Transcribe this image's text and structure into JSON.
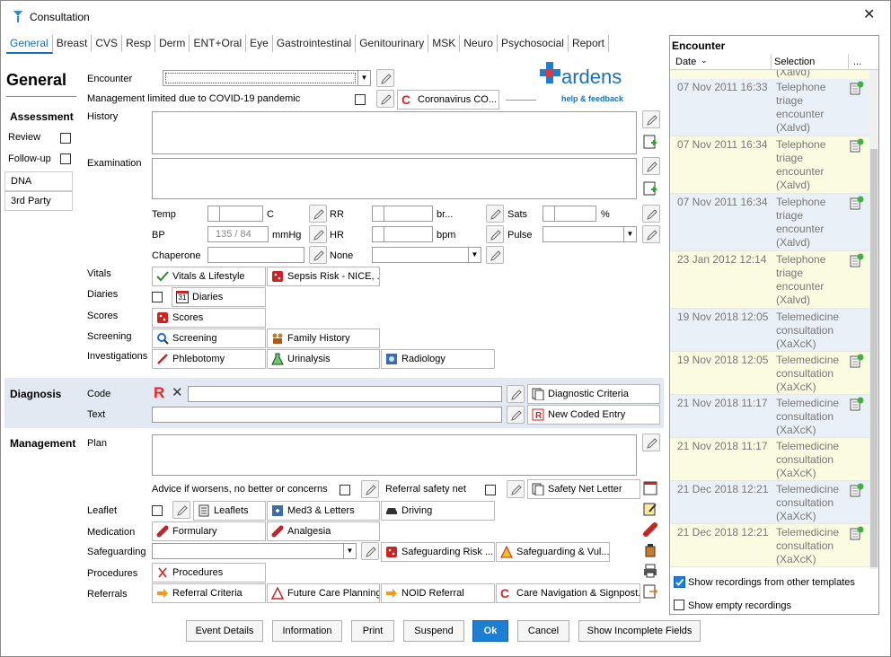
{
  "window": {
    "title": "Consultation"
  },
  "tabs": [
    "General",
    "Breast",
    "CVS",
    "Resp",
    "Derm",
    "ENT+Oral",
    "Eye",
    "Gastrointestinal",
    "Genitourinary",
    "MSK",
    "Neuro",
    "Psychosocial",
    "Report"
  ],
  "general": {
    "heading": "General",
    "encounter_label": "Encounter",
    "covid_label": "Management limited due to COVID-19 pandemic",
    "covid_button": "Coronavirus CO...",
    "history_label": "History",
    "examination_label": "Examination"
  },
  "ardens": {
    "name": "ardens",
    "sub": "help & feedback"
  },
  "assessment": {
    "heading": "Assessment",
    "review": "Review",
    "followup": "Follow-up",
    "dna": "DNA",
    "third_party": "3rd Party"
  },
  "vitals_row": {
    "temp": "Temp",
    "temp_unit": "C",
    "rr": "RR",
    "rr_unit": "br...",
    "sats": "Sats",
    "sats_unit": "%",
    "bp": "BP",
    "bp_placeholder": "135 / 84",
    "bp_unit": "mmHg",
    "hr": "HR",
    "hr_unit": "bpm",
    "pulse": "Pulse",
    "chaperone": "Chaperone",
    "none": "None"
  },
  "rows": {
    "vitals": "Vitals",
    "vitals_btn": "Vitals & Lifestyle",
    "sepsis_btn": "Sepsis Risk - NICE, ...",
    "diaries": "Diaries",
    "diaries_btn": "Diaries",
    "calendar_day": "31",
    "scores": "Scores",
    "scores_btn": "Scores",
    "screening": "Screening",
    "screening_btn": "Screening",
    "family_btn": "Family History",
    "investigations": "Investigations",
    "phlebotomy_btn": "Phlebotomy",
    "urinalysis_btn": "Urinalysis",
    "radiology_btn": "Radiology"
  },
  "diagnosis": {
    "heading": "Diagnosis",
    "code": "Code",
    "text": "Text",
    "r_badge": "R",
    "criteria_btn": "Diagnostic Criteria",
    "coded_btn": "New Coded Entry"
  },
  "management": {
    "heading": "Management",
    "plan": "Plan",
    "advice": "Advice if worsens, no better or concerns",
    "safety_net": "Referral safety net",
    "safety_letter_btn": "Safety Net Letter",
    "leaflet": "Leaflet",
    "leaflets_btn": "Leaflets",
    "med3_btn": "Med3 & Letters",
    "driving_btn": "Driving",
    "medication": "Medication",
    "formulary_btn": "Formulary",
    "analgesia_btn": "Analgesia",
    "safeguarding": "Safeguarding",
    "sg_risk_btn": "Safeguarding Risk ...",
    "sg_vul_btn": "Safeguarding & Vul...",
    "procedures": "Procedures",
    "procedures_btn": "Procedures",
    "referrals": "Referrals",
    "ref_criteria_btn": "Referral Criteria",
    "future_care_btn": "Future Care Planning",
    "noid_btn": "NOID Referral",
    "care_nav_btn": "Care Navigation & Signpost..."
  },
  "encounter_panel": {
    "title": "Encounter",
    "col_date": "Date",
    "col_selection": "Selection",
    "col_more": "...",
    "top_partial": "(Xalvd)",
    "rows": [
      {
        "date": "07 Nov 2011 16:33",
        "lines": [
          "Telephone",
          "triage",
          "encounter",
          "(Xalvd)"
        ],
        "flag": true
      },
      {
        "date": "07 Nov 2011 16:34",
        "lines": [
          "Telephone",
          "triage",
          "encounter",
          "(Xalvd)"
        ],
        "flag": true
      },
      {
        "date": "07 Nov 2011 16:34",
        "lines": [
          "Telephone",
          "triage",
          "encounter",
          "(Xalvd)"
        ],
        "flag": true
      },
      {
        "date": "23 Jan 2012 12:14",
        "lines": [
          "Telephone",
          "triage",
          "encounter",
          "(Xalvd)"
        ],
        "flag": true
      },
      {
        "date": "19 Nov 2018 12:05",
        "lines": [
          "Telemedicine",
          "consultation",
          "(XaXcK)"
        ],
        "flag": false
      },
      {
        "date": "19 Nov 2018 12:05",
        "lines": [
          "Telemedicine",
          "consultation",
          "(XaXcK)"
        ],
        "flag": true
      },
      {
        "date": "21 Nov 2018 11:17",
        "lines": [
          "Telemedicine",
          "consultation",
          "(XaXcK)"
        ],
        "flag": true
      },
      {
        "date": "21 Nov 2018 11:17",
        "lines": [
          "Telemedicine",
          "consultation",
          "(XaXcK)"
        ],
        "flag": false
      },
      {
        "date": "21 Dec 2018 12:21",
        "lines": [
          "Telemedicine",
          "consultation",
          "(XaXcK)"
        ],
        "flag": true
      },
      {
        "date": "21 Dec 2018 12:21",
        "lines": [
          "Telemedicine",
          "consultation",
          "(XaXcK)"
        ],
        "flag": true
      }
    ],
    "show_other": "Show recordings from other templates",
    "show_empty": "Show empty recordings"
  },
  "footer": {
    "event_details": "Event Details",
    "information": "Information",
    "print": "Print",
    "suspend": "Suspend",
    "ok": "Ok",
    "cancel": "Cancel",
    "show_incomplete": "Show Incomplete Fields"
  },
  "colors": {
    "accent": "#1b7fd4",
    "diag_band": "#e2e9f2",
    "row_yellow": "#fbfbe2",
    "row_blue": "#eaf0f8"
  }
}
